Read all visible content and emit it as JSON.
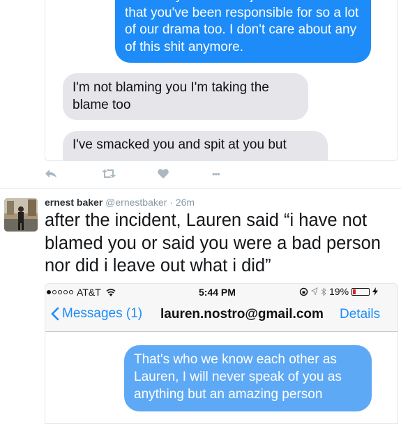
{
  "screenshot1": {
    "outgoing_message": "fact that you've been just as abusive or that you've been responsible for so a lot of our drama too. I don't care about any of this shit anymore.",
    "incoming_messages": [
      "I'm not blaming you I'm taking the blame too",
      "I've smacked you and spit at you but"
    ]
  },
  "actions": {
    "reply_icon": "reply-icon",
    "retweet_icon": "retweet-icon",
    "like_icon": "heart-icon",
    "more_icon": "more-dots-icon",
    "more_label": "•••"
  },
  "tweet": {
    "name": "ernest baker",
    "handle": "@ernestbaker",
    "separator": "·",
    "time": "26m",
    "text": "after the incident, Lauren said “i have not blamed you or said you were a bad person nor did i leave out what i did”"
  },
  "screenshot2": {
    "status": {
      "carrier": "AT&T",
      "time": "5:44 PM",
      "battery": "19%",
      "battery_level": 0.19
    },
    "nav": {
      "back_label": "Messages (1)",
      "title": "lauren.nostro@gmail.com",
      "details": "Details"
    },
    "outgoing_message": "That's who we know each other as Lauren, I will never speak of you as anything but an amazing person"
  },
  "colors": {
    "ios_blue": "#1d8cf8",
    "bubble_gray": "#e5e5ea",
    "icon_gray": "#aab8c2"
  }
}
